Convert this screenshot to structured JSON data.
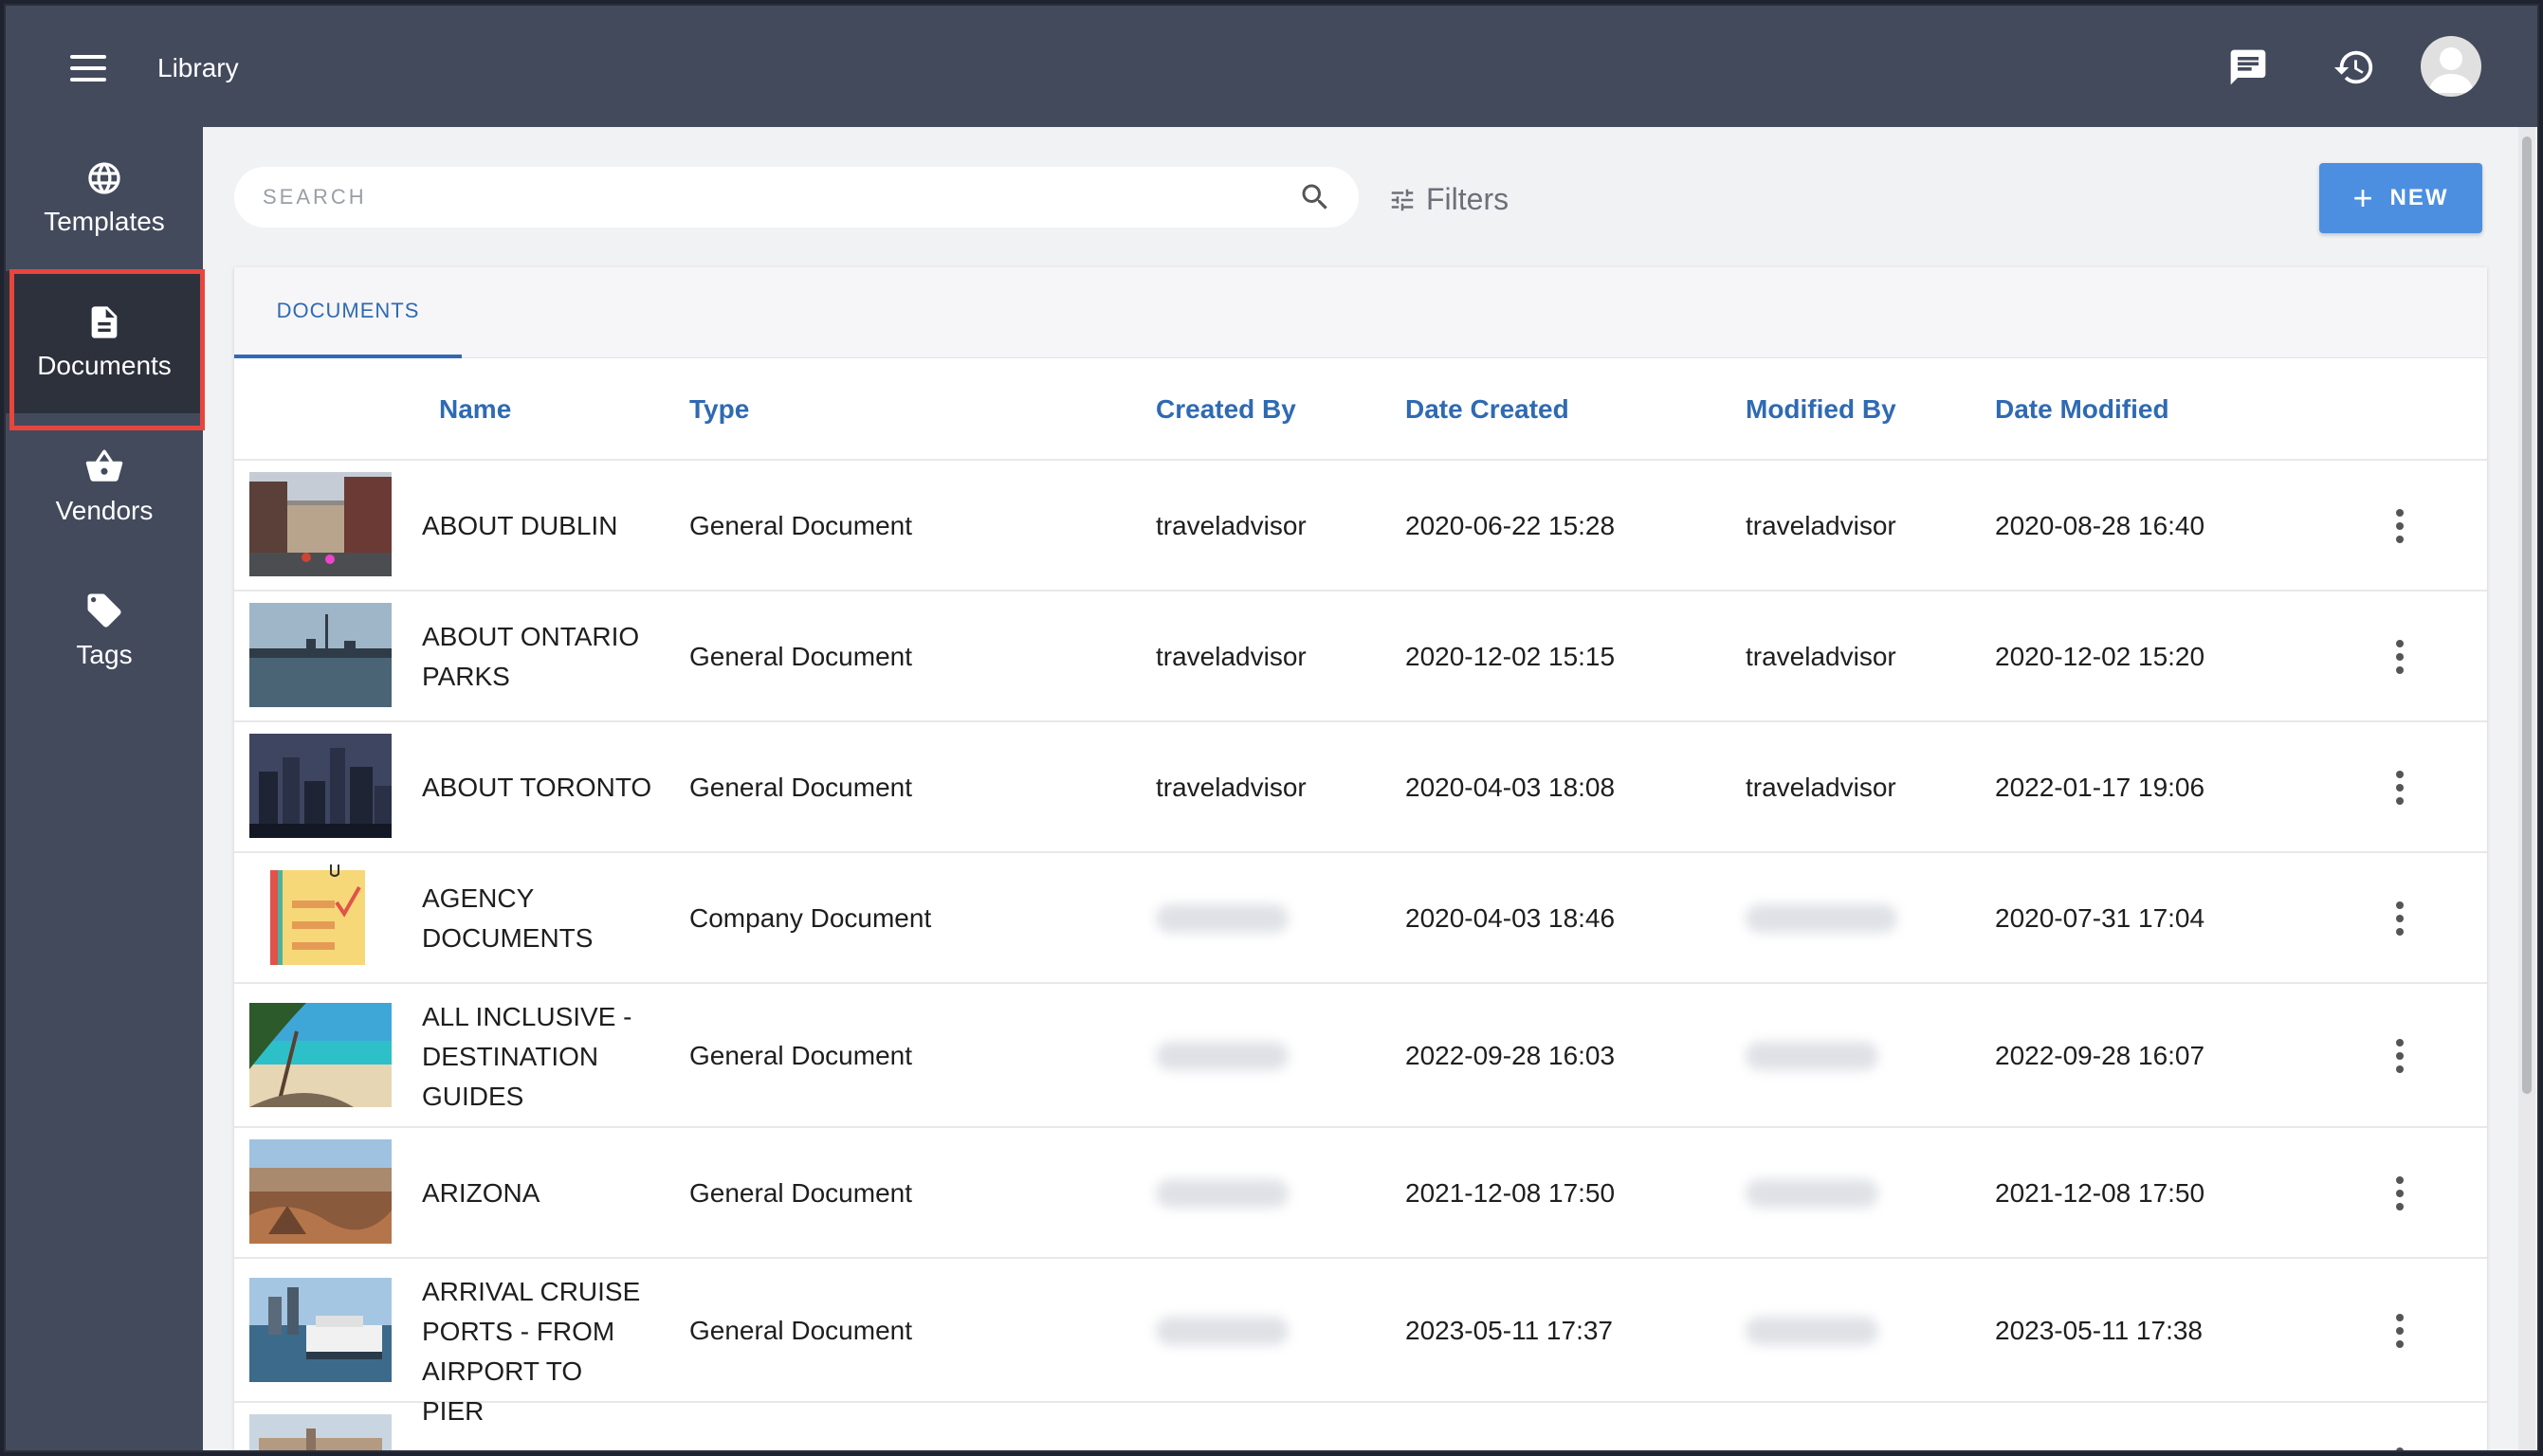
{
  "header": {
    "title": "Library"
  },
  "icons": {
    "chat": "chat-icon",
    "history": "history-icon",
    "account": "avatar"
  },
  "sidebar": {
    "items": [
      {
        "label": "Templates",
        "icon": "globe-icon"
      },
      {
        "label": "Documents",
        "icon": "document-icon"
      },
      {
        "label": "Vendors",
        "icon": "basket-icon"
      },
      {
        "label": "Tags",
        "icon": "tag-icon"
      }
    ]
  },
  "toolbar": {
    "search_placeholder": "SEARCH",
    "filters_label": "Filters",
    "new_label": "NEW"
  },
  "tabs": [
    {
      "label": "DOCUMENTS"
    }
  ],
  "table": {
    "columns": [
      "Name",
      "Type",
      "Created By",
      "Date Created",
      "Modified By",
      "Date Modified"
    ],
    "rows": [
      {
        "name": "ABOUT DUBLIN",
        "type": "General Document",
        "created_by": "traveladvisor",
        "date_created": "2020-06-22 15:28",
        "modified_by": "traveladvisor",
        "date_modified": "2020-08-28 16:40"
      },
      {
        "name": "ABOUT ONTARIO PARKS",
        "type": "General Document",
        "created_by": "traveladvisor",
        "date_created": "2020-12-02 15:15",
        "modified_by": "traveladvisor",
        "date_modified": "2020-12-02 15:20"
      },
      {
        "name": "ABOUT TORONTO",
        "type": "General Document",
        "created_by": "traveladvisor",
        "date_created": "2020-04-03 18:08",
        "modified_by": "traveladvisor",
        "date_modified": "2022-01-17 19:06"
      },
      {
        "name": "AGENCY DOCUMENTS",
        "type": "Company Document",
        "created_by": "",
        "date_created": "2020-04-03 18:46",
        "modified_by": "",
        "date_modified": "2020-07-31 17:04"
      },
      {
        "name": "ALL INCLUSIVE - DESTINATION GUIDES",
        "type": "General Document",
        "created_by": "",
        "date_created": "2022-09-28 16:03",
        "modified_by": "",
        "date_modified": "2022-09-28 16:07"
      },
      {
        "name": "ARIZONA",
        "type": "General Document",
        "created_by": "",
        "date_created": "2021-12-08 17:50",
        "modified_by": "",
        "date_modified": "2021-12-08 17:50"
      },
      {
        "name": "ARRIVAL CRUISE PORTS - FROM AIRPORT TO PIER",
        "type": "General Document",
        "created_by": "",
        "date_created": "2023-05-11 17:37",
        "modified_by": "",
        "date_modified": "2023-05-11 17:38"
      }
    ]
  },
  "colors": {
    "topbar": "#434a5c",
    "active_nav": "#2c313c",
    "accent": "#2f6ab3",
    "new_button": "#4c8fe0",
    "highlight": "#e8453c"
  }
}
